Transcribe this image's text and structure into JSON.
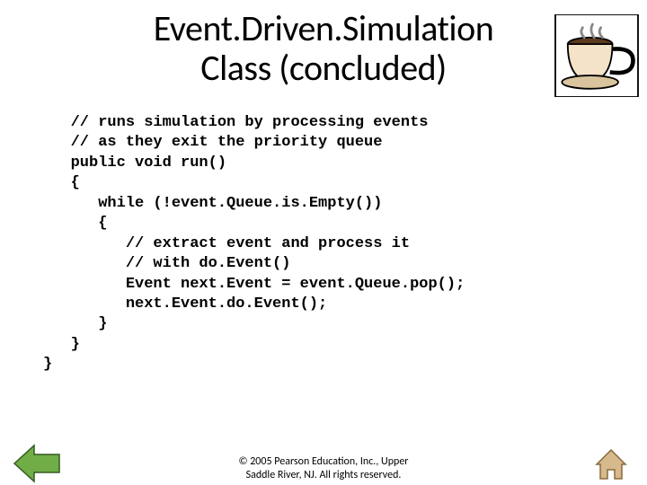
{
  "title": {
    "line1": "Event.Driven.Simulation",
    "line2": "Class (concluded)"
  },
  "code": "   // runs simulation by processing events\n   // as they exit the priority queue\n   public void run()\n   {\n      while (!event.Queue.is.Empty())\n      {\n         // extract event and process it\n         // with do.Event()\n         Event next.Event = event.Queue.pop();\n         next.Event.do.Event();\n      }\n   }\n}",
  "footer": {
    "line1": "© 2005 Pearson Education, Inc., Upper",
    "line2": "Saddle River, NJ. All rights reserved."
  },
  "icons": {
    "cup": "coffee-cup-icon",
    "back": "back-arrow-icon",
    "home": "home-icon"
  }
}
